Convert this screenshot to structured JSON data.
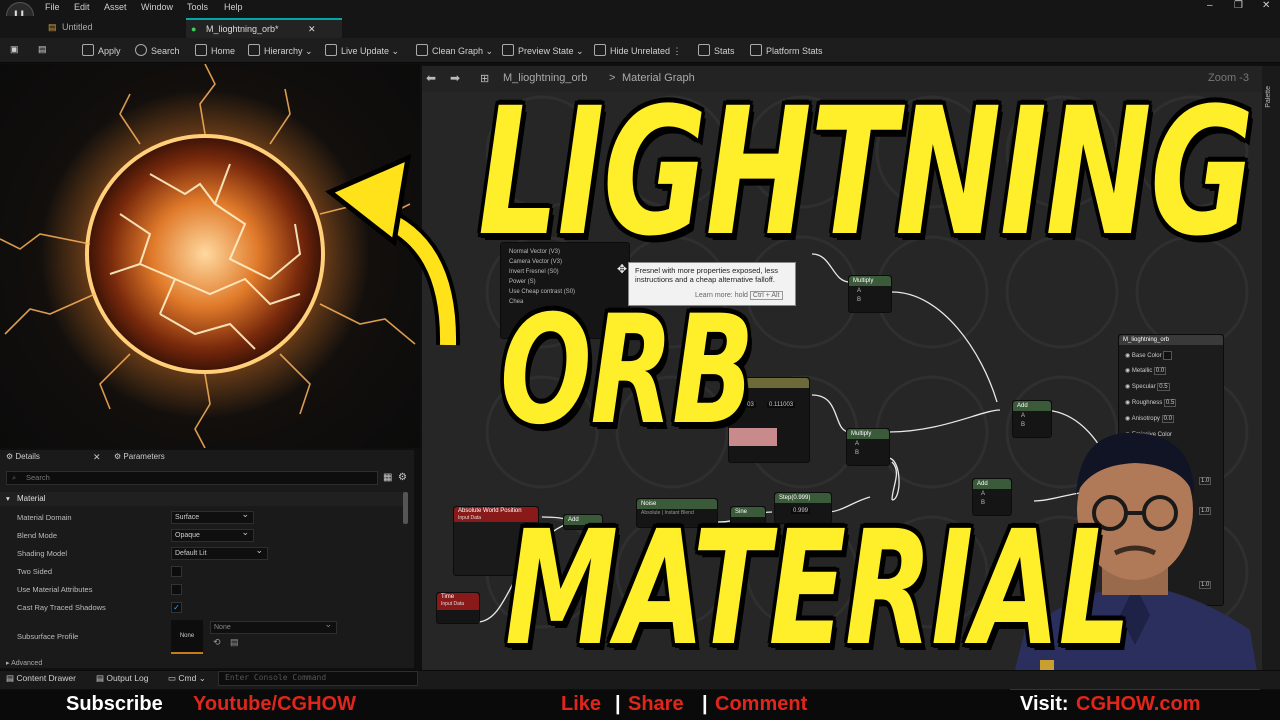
{
  "menu": [
    "File",
    "Edit",
    "Asset",
    "Window",
    "Tools",
    "Help"
  ],
  "tabs": [
    {
      "label": "Untitled"
    },
    {
      "label": "M_lioghtning_orb*"
    }
  ],
  "toolbar": [
    {
      "label": "Apply",
      "icon": "apply-icon"
    },
    {
      "label": "Search",
      "icon": "search-icon"
    },
    {
      "label": "Home",
      "icon": "home-icon"
    },
    {
      "label": "Hierarchy",
      "icon": "hierarchy-icon"
    },
    {
      "label": "Live Update",
      "icon": "live-update-icon"
    },
    {
      "label": "Clean Graph",
      "icon": "clean-graph-icon"
    },
    {
      "label": "Preview State",
      "icon": "preview-state-icon"
    },
    {
      "label": "Hide Unrelated",
      "icon": "hide-unrelated-icon"
    },
    {
      "label": "Stats",
      "icon": "stats-icon"
    },
    {
      "label": "Platform Stats",
      "icon": "platform-stats-icon"
    }
  ],
  "details": {
    "tabs": [
      "Details",
      "Parameters"
    ],
    "search_placeholder": "Search",
    "section": "Material",
    "rows": [
      {
        "label": "Material Domain",
        "value": "Surface"
      },
      {
        "label": "Blend Mode",
        "value": "Opaque"
      },
      {
        "label": "Shading Model",
        "value": "Default Lit"
      },
      {
        "label": "Two Sided",
        "checked": false
      },
      {
        "label": "Use Material Attributes",
        "checked": false
      },
      {
        "label": "Cast Ray Traced Shadows",
        "checked": true
      },
      {
        "label": "Subsurface Profile",
        "thumb": "None",
        "value": "None"
      }
    ],
    "advanced": "Advanced"
  },
  "graph": {
    "breadcrumb_asset": "M_lioghtning_orb",
    "breadcrumb_sep": ">",
    "breadcrumb_page": "Material Graph",
    "zoom": "Zoom -3",
    "palette": "Palette",
    "fresnel_pins": [
      "Normal Vector (V3)",
      "Camera Vector (V3)",
      "Invert Fresnel (S0)",
      "Power (S)",
      "Use Cheap contrast (S0)",
      "Chea"
    ],
    "tooltip": {
      "text": "Fresnel with more properties exposed, less instructions and a cheap alternative falloff.",
      "learn": "Learn more:",
      "hold": "hold",
      "key": "Ctrl + Alt"
    },
    "nodes": {
      "multiply": "Multiply",
      "add": "Add",
      "noise": "Noise",
      "noise_sub": "Absolute | Instant Blend",
      "sine": "Sine",
      "step": "Step(0.999)",
      "step_val": "0.999",
      "awp": "Absolute World Position",
      "awp_sub": "Input Data",
      "time": "Time",
      "time_sub": "Input Data",
      "vec1": ".111003",
      "vec2": "0.111003",
      "pin_a": "A",
      "pin_b": "B"
    },
    "result": {
      "title": "M_lioghtning_orb",
      "pins": [
        {
          "label": "Base Color",
          "value": ""
        },
        {
          "label": "Metallic",
          "value": "0.0"
        },
        {
          "label": "Specular",
          "value": "0.5"
        },
        {
          "label": "Roughness",
          "value": "0.5"
        },
        {
          "label": "Anisotropy",
          "value": "0.0"
        },
        {
          "label": "Emissive Color",
          "value": ""
        }
      ],
      "extra": [
        "1.0",
        "1.0",
        "1.0"
      ]
    }
  },
  "status": {
    "content_drawer": "Content Drawer",
    "output_log": "Output Log",
    "cmd": "Cmd",
    "console_placeholder": "Enter Console Command"
  },
  "overlay": {
    "line1": "LIGHTNING",
    "line2": "ORB",
    "line3": "MATERIAL"
  },
  "promo": {
    "subscribe": "Subscribe",
    "channel": "Youtube/CGHOW",
    "like": "Like",
    "sep": "|",
    "share": "Share",
    "comment": "Comment",
    "visit": "Visit:",
    "site": "CGHOW.com"
  },
  "colors": {
    "title_yellow": "#ffee2a",
    "promo_red": "#e0261b",
    "accent_cyan": "#0aa"
  }
}
